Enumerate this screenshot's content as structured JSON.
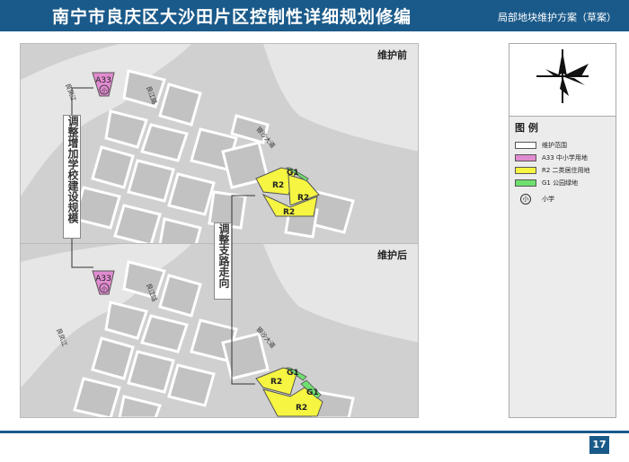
{
  "header": {
    "title": "南宁市良庆区大沙田片区控制性详细规划修编",
    "subtitle": "局部地块维护方案（草案）",
    "bg_color": "#1a5a8a"
  },
  "maps": {
    "before_label": "维护前",
    "after_label": "维护后",
    "road_liangfeng": "良凤江",
    "road_liangjiang": "良江路",
    "road_dasha": "银沙大道",
    "school_code": "A33",
    "school_symbol": "小",
    "before_parcels": [
      "R2",
      "R2",
      "R2",
      "G1"
    ],
    "after_parcels": [
      "R2",
      "R2",
      "G1",
      "G1"
    ]
  },
  "annotations": {
    "school_change": "调整增加学校建设规模",
    "road_change": "调整支路走向"
  },
  "legend": {
    "title": "图 例",
    "items": [
      {
        "label": "维护范围",
        "color": "#ffffff"
      },
      {
        "label": "A33  中小学用地",
        "color": "#e08bd0"
      },
      {
        "label": "R2  二类居住用地",
        "color": "#f5f542"
      },
      {
        "label": "G1  公园绿地",
        "color": "#6ee06e"
      }
    ],
    "school_symbol": "小",
    "school_label": "小学"
  },
  "page_number": "17"
}
